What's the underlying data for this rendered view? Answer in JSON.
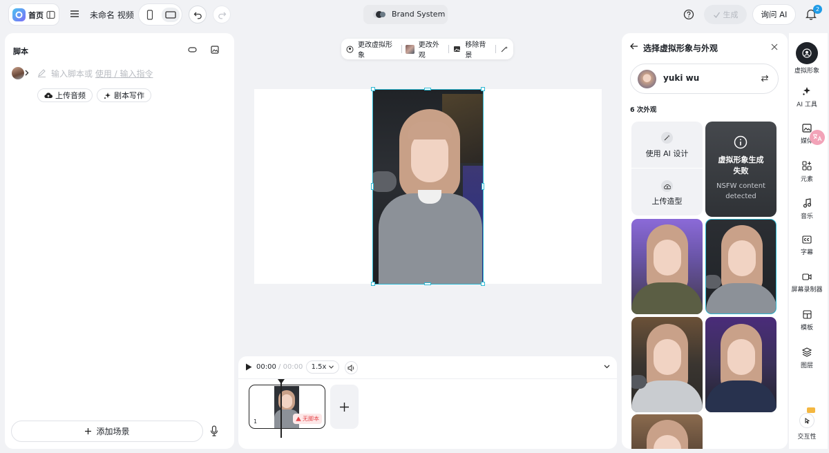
{
  "topbar": {
    "home_label": "首页",
    "title": "未命名 视频",
    "brand": "Brand System",
    "generate_label": "生成",
    "ask_ai_label": "询问 AI",
    "notif_count": "2"
  },
  "script_panel": {
    "title": "脚本",
    "placeholder_main": "输入脚本或",
    "placeholder_link": "使用 / 输入指令",
    "upload_audio": "上传音频",
    "script_writing": "剧本写作",
    "add_scene": "添加场景"
  },
  "canvas_toolbar": {
    "change_avatar": "更改虚拟形象",
    "change_look": "更改外观",
    "remove_bg": "移除背景"
  },
  "timeline": {
    "current_time": "00:00",
    "separator": "/",
    "total_time": "00:00",
    "speed": "1.5x",
    "scene_number": "1",
    "no_script_badge": "无脚本"
  },
  "avatar_panel": {
    "title": "选择虚拟形象与外观",
    "avatar_name": "yuki wu",
    "looks_count": "6 次外观",
    "use_ai_design": "使用 AI 设计",
    "upload_look": "上传造型",
    "failed_title": "虚拟形象生成失败",
    "failed_reason": "NSFW content detected"
  },
  "rail": {
    "items": [
      {
        "label": "虚拟形象",
        "icon": "avatar-icon"
      },
      {
        "label": "AI 工具",
        "icon": "sparkle-icon"
      },
      {
        "label": "媒体",
        "icon": "image-icon"
      },
      {
        "label": "元素",
        "icon": "elements-icon"
      },
      {
        "label": "音乐",
        "icon": "music-icon"
      },
      {
        "label": "字幕",
        "icon": "caption-icon"
      },
      {
        "label": "屏幕录制器",
        "icon": "record-icon"
      },
      {
        "label": "模板",
        "icon": "template-icon"
      },
      {
        "label": "图层",
        "icon": "layers-icon"
      },
      {
        "label": "交互性",
        "icon": "interactivity-icon"
      }
    ]
  },
  "colors": {
    "accent": "#2cb9d4",
    "error": "#e5484d",
    "dark_card": "#3a3d42"
  }
}
